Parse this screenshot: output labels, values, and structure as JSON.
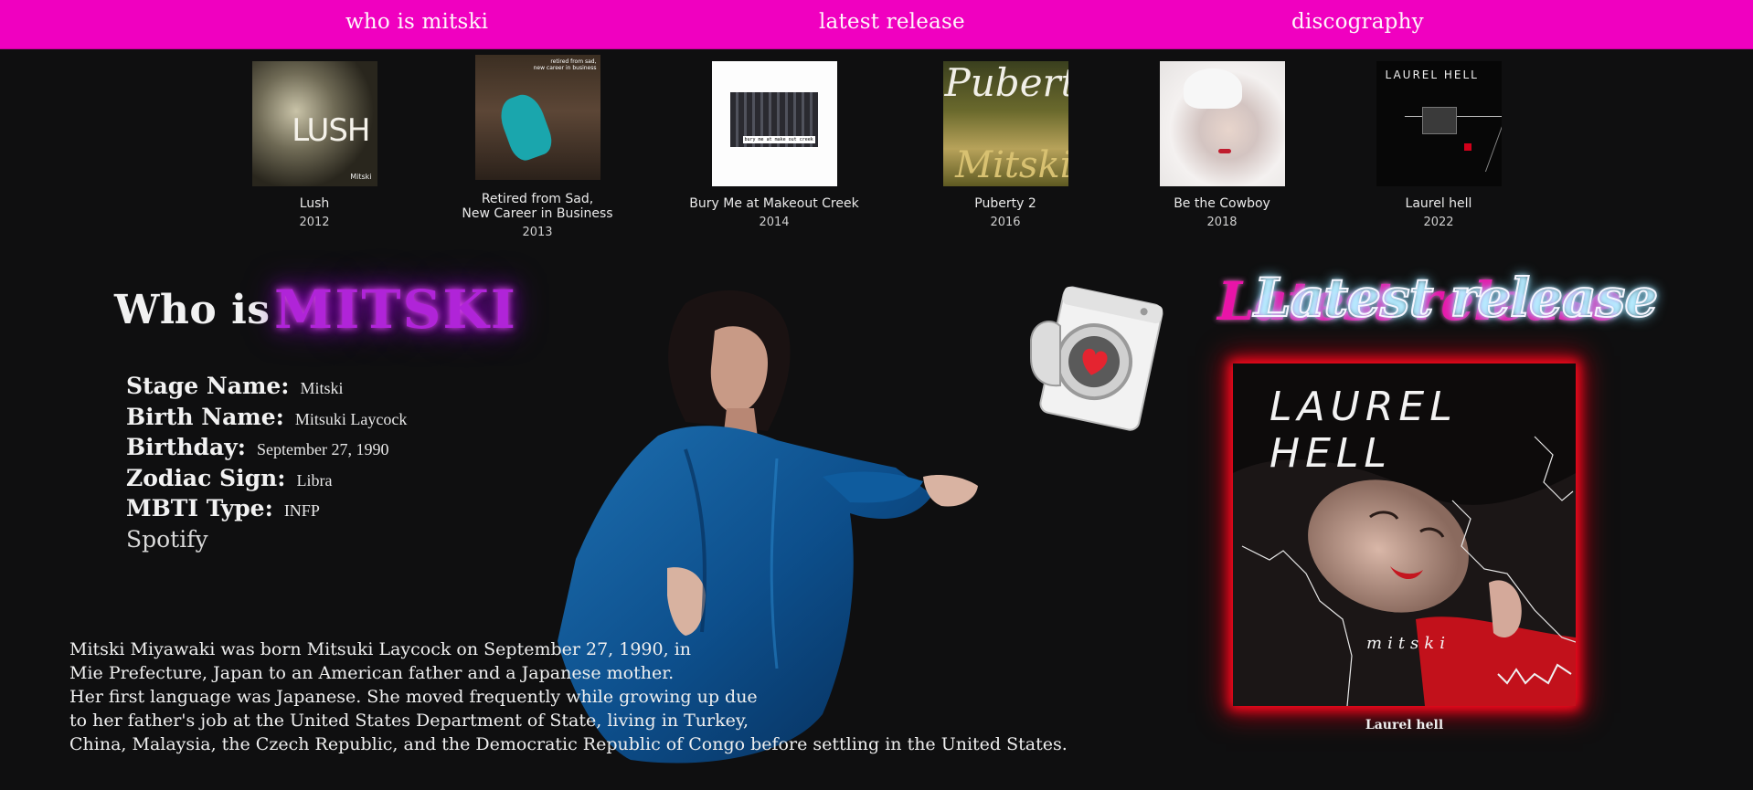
{
  "nav": {
    "who_is": "who is mitski",
    "latest": "latest release",
    "discography": "discography"
  },
  "albums": [
    {
      "title": "Lush",
      "year": "2012",
      "cover_text": "LUSH",
      "cover_artist": "Mitski"
    },
    {
      "title": "Retired from Sad,\nNew Career in Business",
      "year": "2013",
      "cover_text": "retired from sad,\nnew career in business"
    },
    {
      "title": "Bury Me at Makeout Creek",
      "year": "2014",
      "cover_text": "bury me at make out creek"
    },
    {
      "title": "Puberty 2",
      "year": "2016",
      "cover_text": "Puberty",
      "cover_text2": "Mitski"
    },
    {
      "title": "Be the Cowboy",
      "year": "2018"
    },
    {
      "title": "Laurel hell",
      "year": "2022",
      "cover_text": "LAUREL HELL"
    }
  ],
  "who": {
    "who_is": "Who is",
    "name": "MITSKI",
    "facts": [
      {
        "key": "Stage Name:",
        "value": "Mitski"
      },
      {
        "key": "Birth Name:",
        "value": "Mitsuki Laycock"
      },
      {
        "key": "Birthday:",
        "value": "September 27, 1990"
      },
      {
        "key": "Zodiac Sign:",
        "value": "Libra"
      },
      {
        "key": "MBTI Type:",
        "value": "INFP"
      }
    ],
    "spotify": "Spotify",
    "bio": [
      "Mitski Miyawaki was born Mitsuki Laycock on September 27, 1990, in",
      "Mie Prefecture, Japan to an American father and a Japanese mother.",
      "Her first language was Japanese. She moved frequently while growing up due",
      "to her father's job at the United States Department of State, living in Turkey,",
      "China, Malaysia, the Czech Republic, and the Democratic Republic of Congo before settling in the United States."
    ]
  },
  "latest": {
    "heading": "Latest release",
    "cover_title": "LAUREL HELL",
    "cover_artist": "mitski",
    "caption": "Laurel hell"
  },
  "colors": {
    "nav_bg": "#f000c0",
    "page_bg": "#0f0f10",
    "mitski_purple": "#b024d8",
    "latest_pink": "#e914a8",
    "cover_glow": "#ff0a1e"
  }
}
